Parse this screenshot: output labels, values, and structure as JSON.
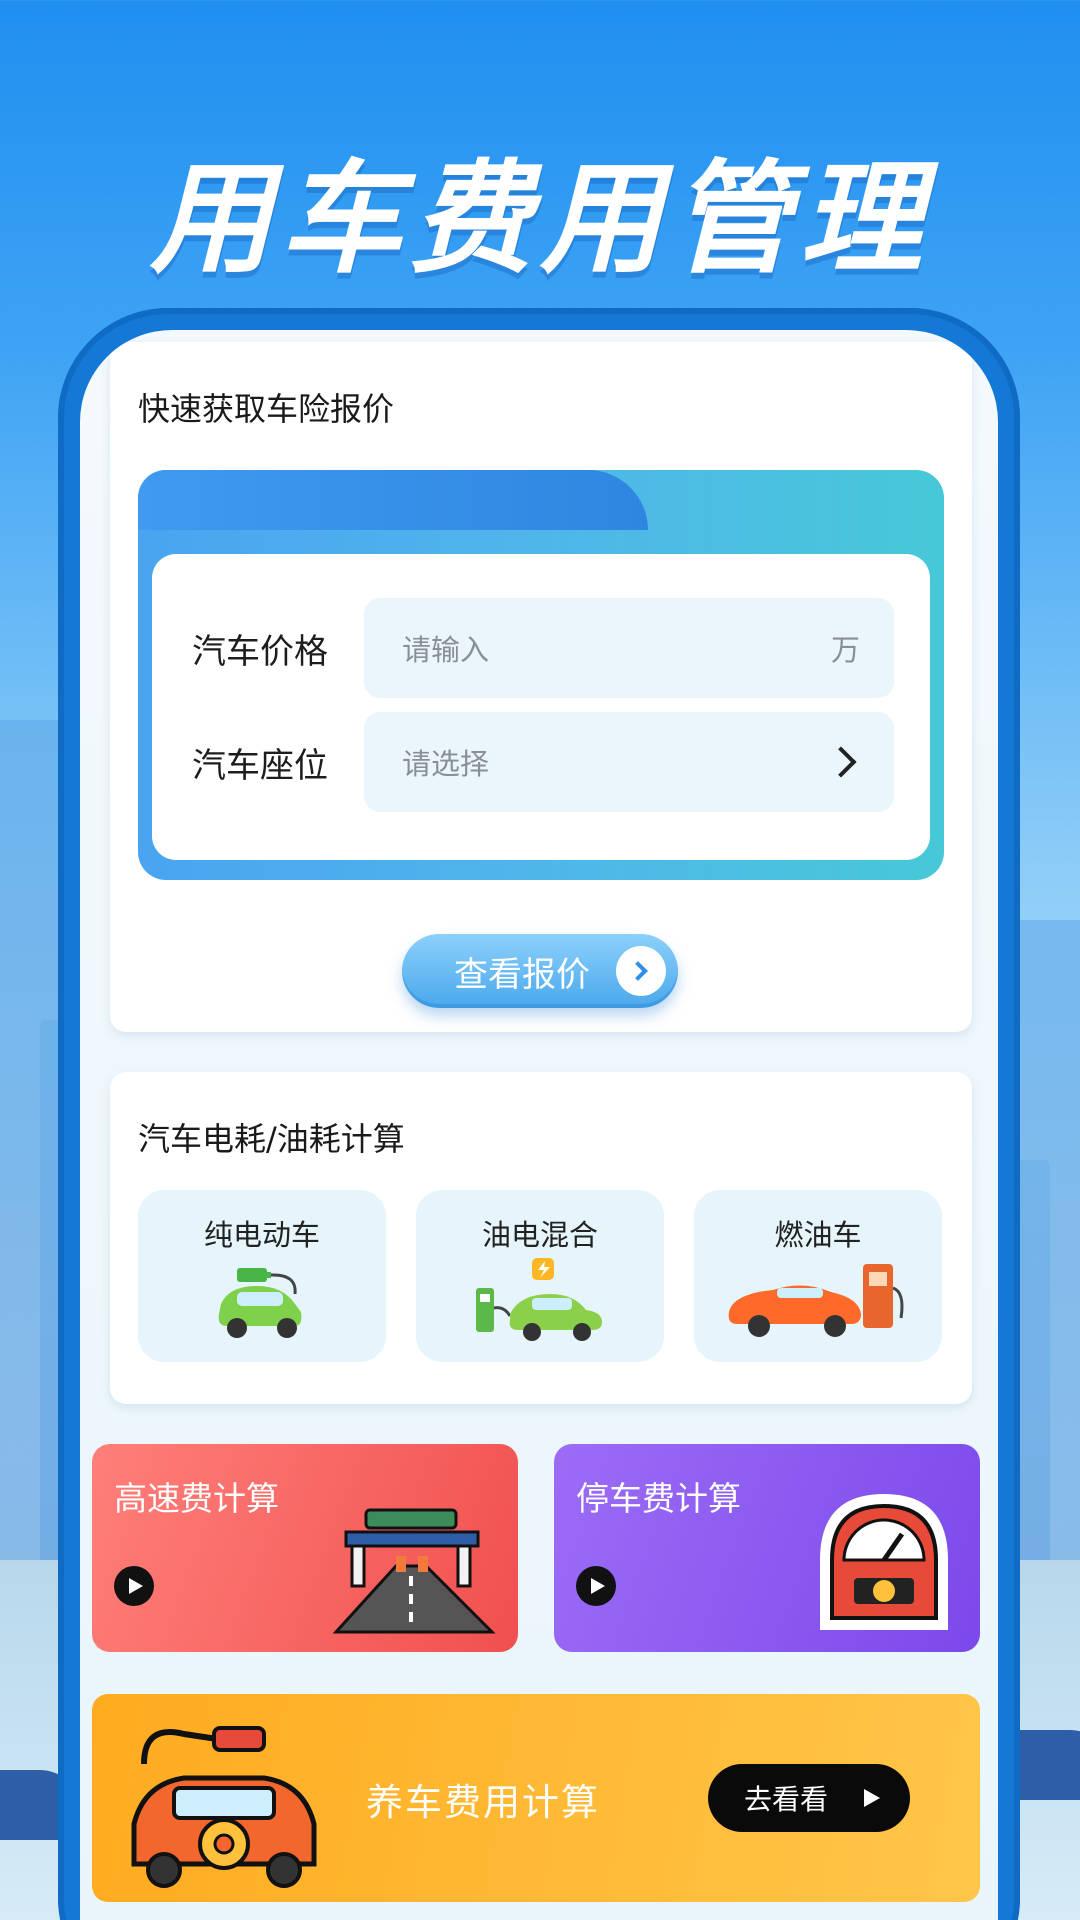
{
  "headline": "用车费用管理",
  "quote_card": {
    "title": "快速获取车险报价",
    "price_label": "汽车价格",
    "price_placeholder": "请输入",
    "price_unit": "万",
    "seat_label": "汽车座位",
    "seat_placeholder": "请选择",
    "button_label": "查看报价"
  },
  "energy_card": {
    "title": "汽车电耗/油耗计算",
    "options": [
      {
        "label": "纯电动车",
        "icon": "electric-car-icon"
      },
      {
        "label": "油电混合",
        "icon": "hybrid-car-icon"
      },
      {
        "label": "燃油车",
        "icon": "fuel-car-icon"
      }
    ]
  },
  "tiles": {
    "highway": {
      "title": "高速费计算",
      "icon": "toll-gate-icon"
    },
    "parking": {
      "title": "停车费计算",
      "icon": "parking-meter-icon"
    },
    "maintenance": {
      "title": "养车费用计算",
      "button_label": "去看看",
      "icon": "car-gear-fuel-icon"
    }
  },
  "colors": {
    "brand_blue": "#1478d6",
    "highway_red": "#f0504f",
    "parking_purple": "#7b49ea",
    "maint_orange": "#ffab1f"
  }
}
